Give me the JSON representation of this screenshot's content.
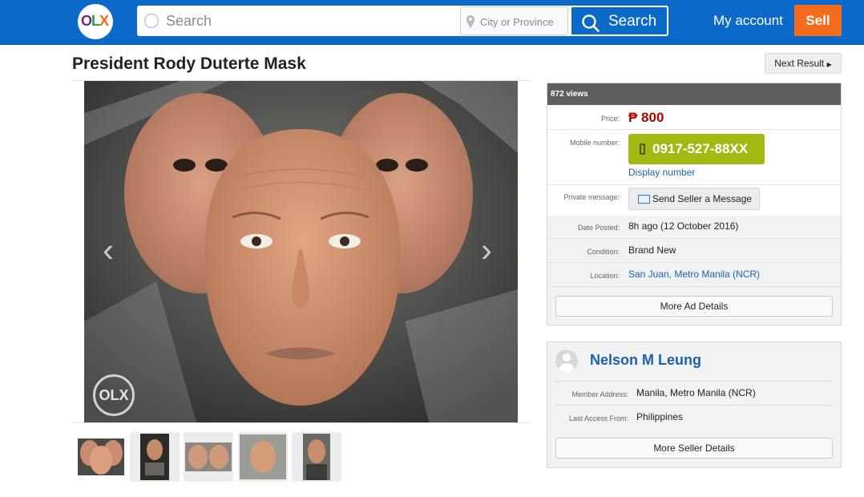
{
  "header": {
    "logo_letters": [
      "O",
      "L",
      "X"
    ],
    "search_placeholder": "Search",
    "city_placeholder": "City or Province",
    "search_button": "Search",
    "my_account": "My account",
    "sell": "Sell",
    "colors": {
      "bar": "#0b69c7",
      "sell": "#f46d1f"
    }
  },
  "listing": {
    "title": "President Rody Duterte Mask",
    "next_result": "Next Result",
    "watermark": "OLX",
    "thumbnail_count": 5
  },
  "details": {
    "views": "872 views",
    "price_label": "Price:",
    "price": "₱ 800",
    "mobile_label": "Mobile number:",
    "mobile": "0917-527-88XX",
    "display_number": "Display number",
    "private_label": "Private message:",
    "send_message": "Send Seller a Message",
    "date_label": "Date Posted:",
    "date": "8h ago (12 October 2016)",
    "condition_label": "Condition:",
    "condition": "Brand New",
    "location_label": "Location:",
    "location": "San Juan, Metro Manila (NCR)",
    "more_ad": "More Ad Details",
    "colors": {
      "phone": "#a3b813",
      "price": "#b00000",
      "link": "#1c5fb0"
    }
  },
  "seller": {
    "name": "Nelson M Leung",
    "address_label": "Member Address:",
    "address": "Manila, Metro Manila (NCR)",
    "access_label": "Last Access From:",
    "access": "Philippines",
    "more_seller": "More Seller Details"
  }
}
